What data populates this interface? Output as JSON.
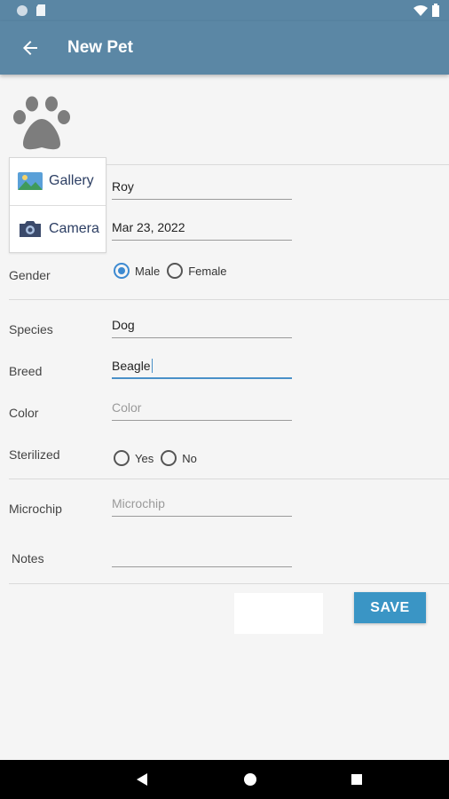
{
  "app_bar": {
    "title": "New Pet"
  },
  "photo_menu": {
    "gallery_label": "Gallery",
    "camera_label": "Camera"
  },
  "form": {
    "name": {
      "value": "Roy"
    },
    "birth_date": {
      "value": "Mar 23, 2022"
    },
    "gender": {
      "label": "Gender",
      "options": [
        "Male",
        "Female"
      ],
      "selected": "Male"
    },
    "species": {
      "label": "Species",
      "value": "Dog"
    },
    "breed": {
      "label": "Breed",
      "value": "Beagle"
    },
    "color": {
      "label": "Color",
      "placeholder": "Color"
    },
    "sterilized": {
      "label": "Sterilized",
      "options": [
        "Yes",
        "No"
      ],
      "selected": null
    },
    "microchip": {
      "label": "Microchip",
      "placeholder": "Microchip"
    },
    "notes": {
      "label": "Notes",
      "value": ""
    }
  },
  "actions": {
    "save_label": "SAVE"
  },
  "colors": {
    "app_bar": "#5b87a5",
    "accent": "#3a95c5",
    "radio_checked": "#3d8ad1"
  }
}
